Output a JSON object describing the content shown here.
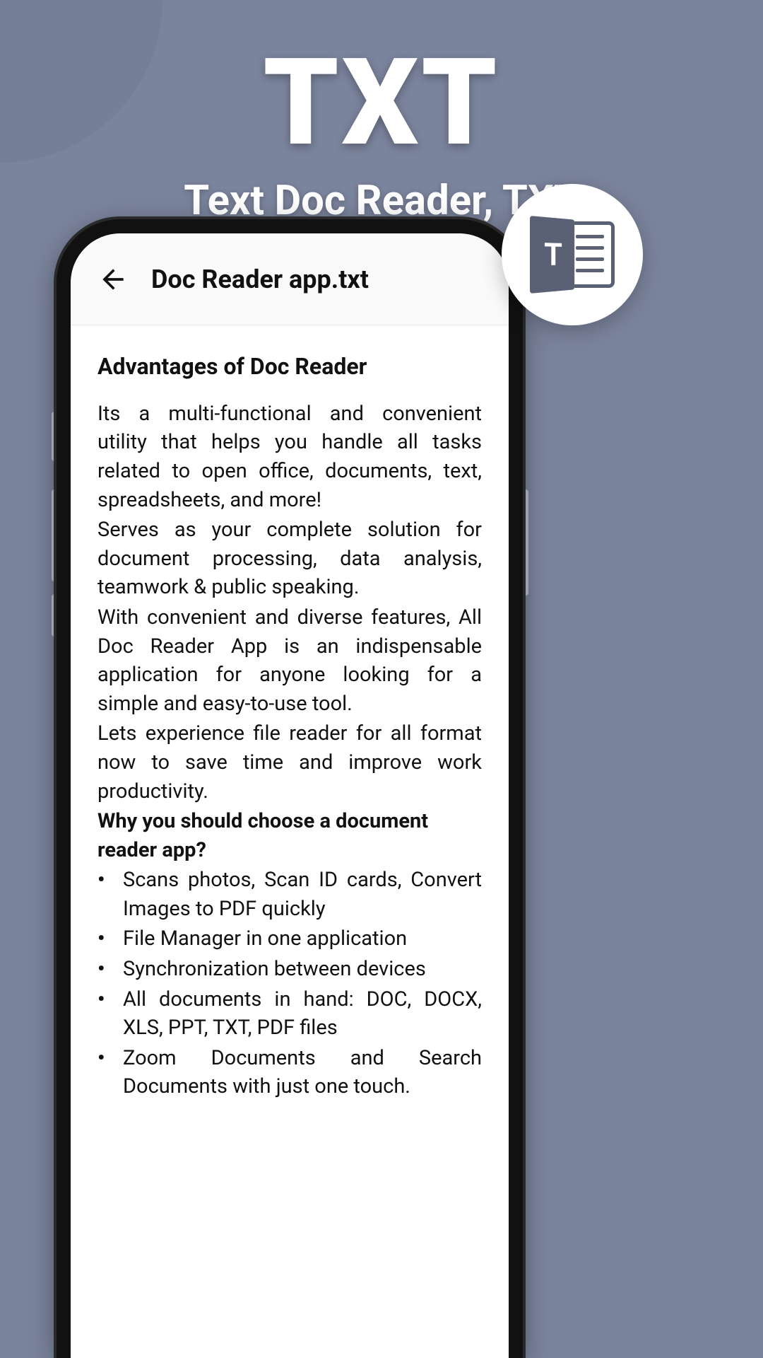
{
  "header": {
    "title": "TXT",
    "subtitle": "Text Doc Reader, TXT"
  },
  "app": {
    "fileTitle": "Doc Reader app.txt"
  },
  "document": {
    "heading": "Advantages of Doc Reader",
    "para1": "Its a multi-functional and convenient utility that helps you handle all tasks related to open office, documents, text, spreadsheets, and more!",
    "para2": "Serves as your complete solution for document processing, data analysis, teamwork & public speaking.",
    "para3": "With convenient and diverse features, All Doc Reader App is an indispensable application for anyone looking for a simple and easy-to-use tool.",
    "para4": "Lets experience file reader for all format now to save time and improve work productivity.",
    "subheading": "Why you should choose a document reader app?",
    "bullets": [
      "Scans photos, Scan ID cards, Convert Images to PDF quickly",
      "File Manager in one application",
      "Synchronization between devices",
      "All documents in hand: DOC, DOCX, XLS, PPT, TXT, PDF files",
      "Zoom Documents and Search Documents with just one touch."
    ]
  },
  "badge": {
    "letter": "T"
  }
}
